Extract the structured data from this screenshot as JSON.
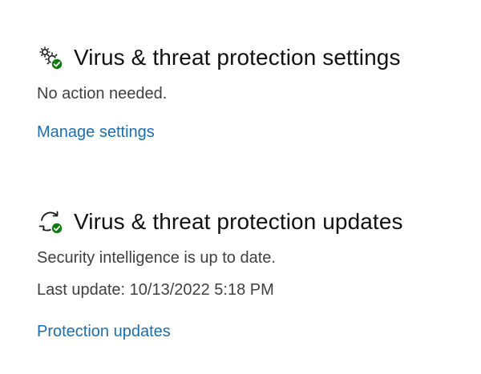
{
  "settings_section": {
    "icon": "gear-with-check-icon",
    "title": "Virus & threat protection settings",
    "status": "No action needed.",
    "link_label": "Manage settings"
  },
  "updates_section": {
    "icon": "refresh-with-check-icon",
    "title": "Virus & threat protection updates",
    "status": "Security intelligence is up to date.",
    "last_update": "Last update: 10/13/2022 5:18 PM",
    "link_label": "Protection updates"
  },
  "colors": {
    "link": "#1a6fb0",
    "check_badge": "#107c10",
    "title": "#111111",
    "body_text": "#3f3f3f"
  }
}
